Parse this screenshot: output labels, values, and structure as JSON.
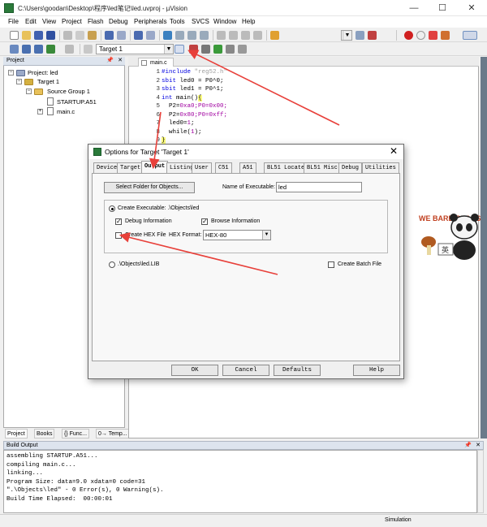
{
  "window": {
    "title": "C:\\Users\\goodan\\Desktop\\程序\\led笔记\\led.uvproj - µVision",
    "minimize": "—",
    "maximize": "☐",
    "close": "✕"
  },
  "menu": [
    "File",
    "Edit",
    "View",
    "Project",
    "Flash",
    "Debug",
    "Peripherals",
    "Tools",
    "SVCS",
    "Window",
    "Help"
  ],
  "toolbar2": {
    "target": "Target 1"
  },
  "project": {
    "header": "Project",
    "pin": "📌",
    "close": "✕",
    "root": "Project: led",
    "target": "Target 1",
    "group": "Source Group 1",
    "files": [
      "STARTUP.A51",
      "main.c"
    ],
    "tabs": [
      "Project",
      "Books",
      "{} Func...",
      "0→ Temp..."
    ]
  },
  "editor": {
    "tab": "main.c",
    "lines": [
      {
        "n": "1",
        "a": "#include ",
        "b": "\"reg52.h\"",
        "c": ""
      },
      {
        "n": "2",
        "a": "sbit ",
        "b": "led0 = P0^0;",
        "c": ""
      },
      {
        "n": "3",
        "a": "sbit ",
        "b": "led1 = P0^1;",
        "c": ""
      },
      {
        "n": "4",
        "a": "int ",
        "b": "main()",
        "c": "{"
      },
      {
        "n": "5",
        "a": "  P2=",
        "b": "0xa0",
        "c": ";P0=0x00;"
      },
      {
        "n": "6",
        "a": "  P2=",
        "b": "0x80",
        "c": ";P0=0xff;"
      },
      {
        "n": "7",
        "a": "  led0=",
        "b": "1",
        "c": ";"
      },
      {
        "n": "8",
        "a": "  while(",
        "b": "1",
        "c": ");"
      },
      {
        "n": "9",
        "a": "",
        "b": "",
        "c": "}"
      }
    ]
  },
  "dialog": {
    "title": "Options for Target 'Target 1'",
    "close": "✕",
    "tabs": [
      "Device",
      "Target",
      "Output",
      "Listing",
      "User",
      "C51",
      "A51",
      "BL51 Locate",
      "BL51 Misc",
      "Debug",
      "Utilities"
    ],
    "active_tab": "Output",
    "select_folder": "Select Folder for Objects...",
    "name_label": "Name of Executable:",
    "name_value": "led",
    "create_exec": "Create Executable:  .\\Objects\\led",
    "debug_info": "Debug Information",
    "browse_info": "Browse Information",
    "create_hex": "Create HEX File",
    "hex_format_label": "HEX Format:",
    "hex_format_value": "HEX-80",
    "create_lib": ".\\Objects\\led.LIB",
    "create_batch": "Create Batch File",
    "ok": "OK",
    "cancel": "Cancel",
    "defaults": "Defaults",
    "help": "Help"
  },
  "build": {
    "header": "Build Output",
    "lines": [
      "assembling STARTUP.A51...",
      "compiling main.c...",
      "linking...",
      "Program Size: data=9.0 xdata=0 code=31",
      "\".\\Objects\\led\" - 0 Error(s), 0 Warning(s).",
      "Build Time Elapsed:  00:00:01"
    ]
  },
  "status": {
    "mode": "Simulation"
  },
  "sticker": {
    "brand": "WE BARE BEARS",
    "cn": "英"
  },
  "colors": {
    "arrow": "#e8403a",
    "keyword": "#0000e0",
    "accent": "#2a7a3a"
  }
}
